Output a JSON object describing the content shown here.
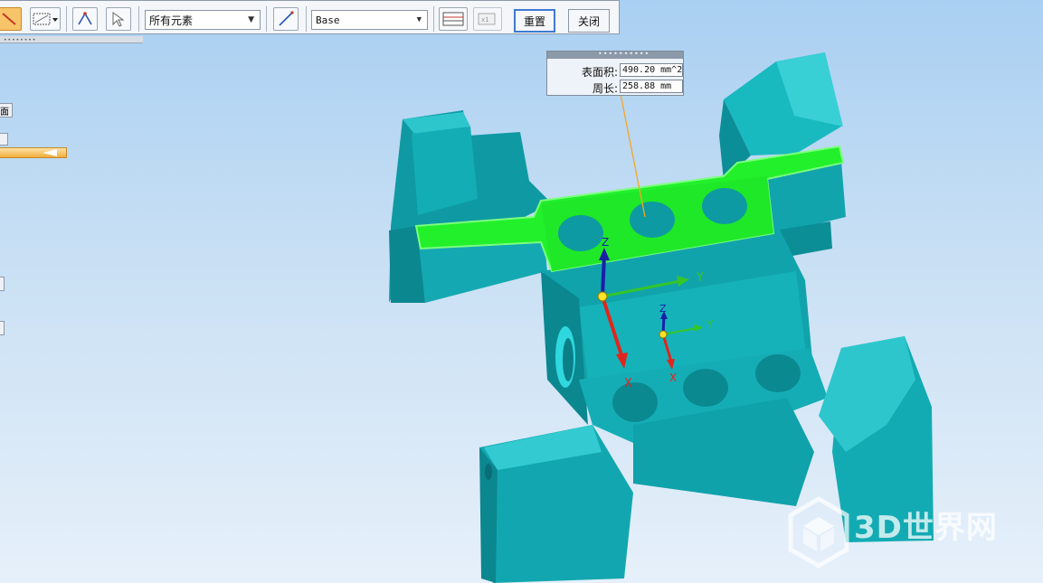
{
  "toolbar": {
    "filter_select": "所有元素",
    "layer_select": "Base",
    "reset_label": "重置",
    "close_label": "关闭"
  },
  "left_panel": {
    "partial_label": "面"
  },
  "measure_popup": {
    "area_label": "表面积:",
    "area_value": "490.20 mm^2",
    "perimeter_label": "周长:",
    "perimeter_value": "258.88 mm"
  },
  "triad_primary": {
    "x": "X",
    "y": "Y",
    "z": "Z"
  },
  "triad_secondary": {
    "x": "X",
    "y": "Y",
    "z": "Z"
  },
  "watermark": {
    "text": "3D世界网"
  },
  "colors": {
    "part": "#17b5bd",
    "part_dark": "#0e8f98",
    "part_light": "#3fd0d6",
    "highlight": "#22f02a",
    "axis_x": "#e0261c",
    "axis_y": "#35c52a",
    "axis_z": "#1b1fa8"
  },
  "icons": [
    "line-measure-icon",
    "grid-dropdown-icon",
    "angle-measure-icon",
    "select-icon",
    "line-tool-icon",
    "table-icon",
    "copy-values-icon"
  ]
}
